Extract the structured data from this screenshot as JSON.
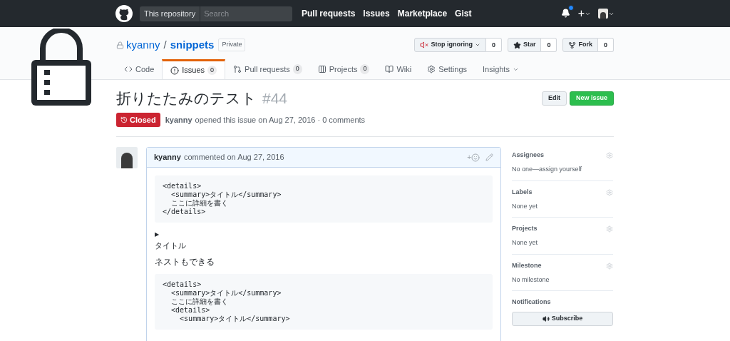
{
  "header": {
    "scope": "This repository",
    "search_placeholder": "Search",
    "nav": [
      "Pull requests",
      "Issues",
      "Marketplace",
      "Gist"
    ],
    "notification_unread": true,
    "new_symbol": "+"
  },
  "repo": {
    "owner": "kyanny",
    "separator": "/",
    "name": "snippets",
    "visibility": "Private",
    "actions": [
      {
        "kind": "watch",
        "label": "Stop ignoring",
        "count": "0"
      },
      {
        "kind": "star",
        "label": "Star",
        "count": "0"
      },
      {
        "kind": "fork",
        "label": "Fork",
        "count": "0"
      }
    ],
    "tabs": [
      {
        "kind": "code",
        "label": "Code",
        "selected": false
      },
      {
        "kind": "issues",
        "label": "Issues",
        "count": "0",
        "selected": true
      },
      {
        "kind": "pulls",
        "label": "Pull requests",
        "count": "0",
        "selected": false
      },
      {
        "kind": "projects",
        "label": "Projects",
        "count": "0",
        "selected": false
      },
      {
        "kind": "wiki",
        "label": "Wiki",
        "selected": false
      },
      {
        "kind": "settings",
        "label": "Settings",
        "selected": false
      },
      {
        "kind": "insights",
        "label": "Insights",
        "selected": false
      }
    ]
  },
  "issue": {
    "title": "折りたたみのテスト",
    "number": "#44",
    "buttons": [
      "Edit",
      "New issue"
    ],
    "state": "Closed",
    "author": "kyanny",
    "meta": "opened this issue on Aug 27, 2016 · 0 comments"
  },
  "comment": {
    "author": "kyanny",
    "meta": "commented on Aug 27, 2016",
    "reaction_symbol": "+",
    "body": [
      {
        "kind": "code",
        "lines": [
          "<details>",
          "  <summary>タイトル</summary>",
          "  ここに詳細を書く",
          "</details>"
        ]
      },
      {
        "kind": "summary",
        "marker": "▶",
        "text": "タイトル"
      },
      {
        "kind": "text",
        "text": "ネストもできる"
      },
      {
        "kind": "code",
        "lines": [
          "<details>",
          "  <summary>タイトル</summary>",
          "  ここに詳細を書く",
          "  <details>",
          "    <summary>タイトル</summary>"
        ]
      }
    ]
  },
  "sidebar": [
    {
      "heading": "Assignees",
      "value": "No one—assign yourself",
      "gear": true
    },
    {
      "heading": "Labels",
      "value": "None yet",
      "gear": true
    },
    {
      "heading": "Projects",
      "value": "None yet",
      "gear": true
    },
    {
      "heading": "Milestone",
      "value": "No milestone",
      "gear": true
    },
    {
      "heading": "Notifications",
      "button": "Subscribe",
      "gear": false
    }
  ]
}
